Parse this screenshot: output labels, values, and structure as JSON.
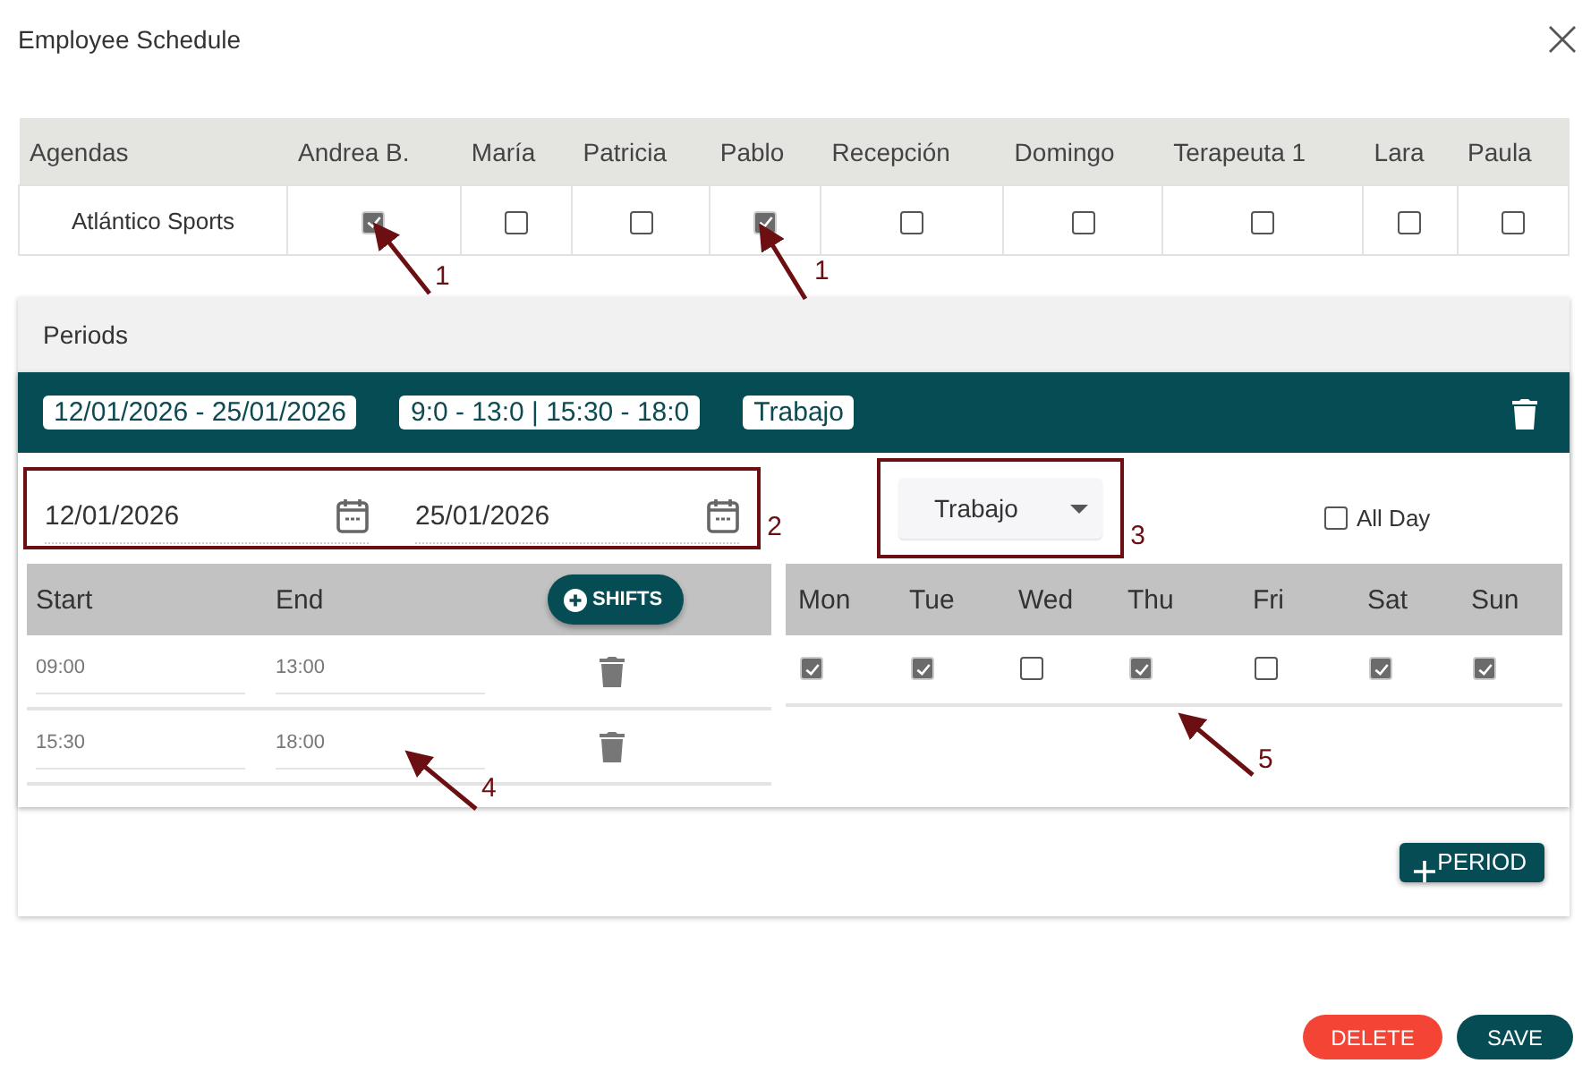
{
  "dialog": {
    "title": "Employee Schedule"
  },
  "agenda_table": {
    "columns": [
      "Agendas",
      "Andrea B.",
      "María",
      "Patricia",
      "Pablo",
      "Recepción",
      "Domingo",
      "Terapeuta 1",
      "Lara",
      "Paula"
    ],
    "rows": [
      {
        "name": "Atlántico Sports",
        "checked": [
          true,
          false,
          false,
          true,
          false,
          false,
          false,
          false,
          false
        ]
      }
    ]
  },
  "periods": {
    "title": "Periods",
    "period": {
      "chips": [
        "12/01/2026 - 25/01/2026",
        "9:0 - 13:0 | 15:30 - 18:0",
        "Trabajo"
      ],
      "start_date": "12/01/2026",
      "end_date": "25/01/2026",
      "date_callout": "2",
      "type": "Trabajo",
      "type_callout": "3",
      "all_day": {
        "label": "All Day",
        "checked": false
      },
      "shift_columns": [
        "Start",
        "End"
      ],
      "shifts_button": "SHIFTS",
      "shifts": [
        {
          "start": "09:00",
          "end": "13:00"
        },
        {
          "start": "15:30",
          "end": "18:00"
        }
      ],
      "days": [
        {
          "label": "Mon",
          "checked": true
        },
        {
          "label": "Tue",
          "checked": true
        },
        {
          "label": "Wed",
          "checked": false
        },
        {
          "label": "Thu",
          "checked": true
        },
        {
          "label": "Fri",
          "checked": false
        },
        {
          "label": "Sat",
          "checked": true
        },
        {
          "label": "Sun",
          "checked": true
        }
      ]
    },
    "add_button": "PERIOD"
  },
  "buttons": [
    {
      "label": "DELETE",
      "kind": "danger"
    },
    {
      "label": "SAVE",
      "kind": "primary"
    }
  ],
  "annotations": [
    {
      "label": "1"
    },
    {
      "label": "1"
    },
    {
      "label": "4"
    },
    {
      "label": "5"
    }
  ]
}
